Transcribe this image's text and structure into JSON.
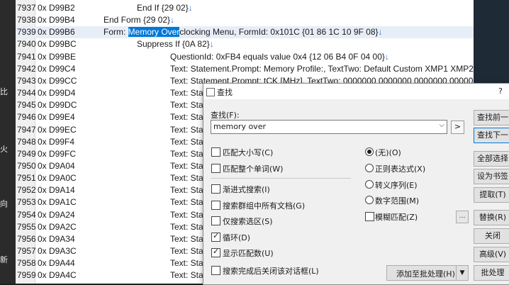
{
  "left_strip": [
    "比",
    "火",
    "向",
    "新"
  ],
  "lines": [
    {
      "num": "7937",
      "addr": "0x D99B2",
      "code": "End If {29 02}"
    },
    {
      "num": "7938",
      "addr": "0x D99B4",
      "code": "End Form {29 02}"
    },
    {
      "num": "7939",
      "addr": "0x D99B6",
      "pre": "Form: ",
      "match": "Memory Over",
      "post": "clocking Menu, FormId: 0x101C {01 86 1C 10 9F 08}"
    },
    {
      "num": "7940",
      "addr": "0x D99BC",
      "code": "Suppress If {0A 82}"
    },
    {
      "num": "7941",
      "addr": "0x D99BE",
      "code": "QuestionId: 0xFB4 equals value 0x4 {12 06 B4 0F 04 00}"
    },
    {
      "num": "7942",
      "addr": "0x D99C4",
      "code": "Text: Statement.Prompt: Memory Profile:, TextTwo: Default Custom  XMP1  XMP2"
    },
    {
      "num": "7943",
      "addr": "0x D99CC",
      "code": "Text: Statement.Prompt: tCK [MHz], TextTwo: 0000000 0000000 0000000 0000000"
    },
    {
      "num": "7944",
      "addr": "0x D99D4",
      "code": "Text: Sta"
    },
    {
      "num": "7945",
      "addr": "0x D99DC",
      "code": "Text: Sta"
    },
    {
      "num": "7946",
      "addr": "0x D99E4",
      "code": "Text: Sta"
    },
    {
      "num": "7947",
      "addr": "0x D99EC",
      "code": "Text: Sta"
    },
    {
      "num": "7948",
      "addr": "0x D99F4",
      "code": "Text: Sta"
    },
    {
      "num": "7949",
      "addr": "0x D99FC",
      "code": "Text: Sta"
    },
    {
      "num": "7950",
      "addr": "0x D9A04",
      "code": "Text: Sta"
    },
    {
      "num": "7951",
      "addr": "0x D9A0C",
      "code": "Text: Sta"
    },
    {
      "num": "7952",
      "addr": "0x D9A14",
      "code": "Text: Sta"
    },
    {
      "num": "7953",
      "addr": "0x D9A1C",
      "code": "Text: Sta"
    },
    {
      "num": "7954",
      "addr": "0x D9A24",
      "code": "Text: Sta"
    },
    {
      "num": "7955",
      "addr": "0x D9A2C",
      "code": "Text: Sta"
    },
    {
      "num": "7956",
      "addr": "0x D9A34",
      "code": "Text: Sta"
    },
    {
      "num": "7957",
      "addr": "0x D9A3C",
      "code": "Text: Sta"
    },
    {
      "num": "7958",
      "addr": "0x D9A44",
      "code": "Text: Sta"
    },
    {
      "num": "7959",
      "addr": "0x D9A4C",
      "code": "Text: Sta"
    }
  ],
  "find_dialog": {
    "title": "查找",
    "help": "?",
    "find_label": "查找(F):",
    "find_value": "memory over",
    "go_button": ">",
    "options": {
      "match_case": {
        "label": "匹配大小写(C)",
        "checked": false
      },
      "whole_word": {
        "label": "匹配整个单词(W)",
        "checked": false
      },
      "incremental": {
        "label": "渐进式搜索(I)",
        "checked": false
      },
      "search_all_docs": {
        "label": "搜索群组中所有文档(G)",
        "checked": false
      },
      "selection_only": {
        "label": "仅搜索选区(S)",
        "checked": false
      },
      "wrap": {
        "label": "循环(D)",
        "checked": true
      },
      "show_count": {
        "label": "显示匹配数(U)",
        "checked": true
      },
      "close_after": {
        "label": "搜索完成后关闭该对话框(L)",
        "checked": false
      }
    },
    "modes": {
      "none": {
        "label": "(无)(O)",
        "selected": true
      },
      "regex": {
        "label": "正则表达式(X)",
        "selected": false
      },
      "escape": {
        "label": "转义序列(E)",
        "selected": false
      },
      "numeric": {
        "label": "数字范围(M)",
        "selected": false
      }
    },
    "fuzzy": {
      "label": "模糊匹配(Z)",
      "checked": false
    },
    "buttons": {
      "find_prev": "查找前一",
      "find_next": "查找下一",
      "select_all": "全部选择",
      "bookmark": "设为书签",
      "extract": "提取(T)",
      "replace": "替换(R)",
      "close": "关闭",
      "advanced": "高级(V)",
      "batch": "批处理",
      "add_batch": "添加至批处理(H)"
    }
  }
}
